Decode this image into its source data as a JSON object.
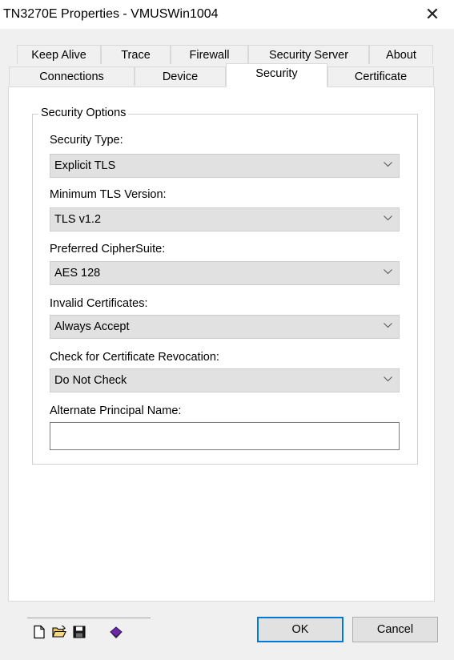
{
  "window": {
    "title": "TN3270E Properties - VMUSWin1004",
    "close_glyph": "✕"
  },
  "tabs": {
    "row1": [
      "Keep Alive",
      "Trace",
      "Firewall",
      "Security Server",
      "About"
    ],
    "row2": [
      "Connections",
      "Device",
      "Security",
      "Certificate"
    ],
    "active": "Security"
  },
  "security": {
    "group_title": "Security Options",
    "fields": [
      {
        "label": "Security Type:",
        "value": "Explicit TLS"
      },
      {
        "label": "Minimum TLS Version:",
        "value": "TLS v1.2"
      },
      {
        "label": "Preferred CipherSuite:",
        "value": "AES 128"
      },
      {
        "label": "Invalid Certificates:",
        "value": "Always Accept"
      },
      {
        "label": "Check for Certificate Revocation:",
        "value": "Do Not Check"
      }
    ],
    "alt_principal": {
      "label": "Alternate Principal Name:",
      "value": ""
    }
  },
  "toolbar": {
    "icons": [
      "new-document-icon",
      "open-folder-icon",
      "save-disk-icon",
      "book-icon"
    ]
  },
  "buttons": {
    "ok": "OK",
    "cancel": "Cancel"
  },
  "colors": {
    "default_button_border": "#0078d7",
    "panel_bg": "#ffffff",
    "window_bg": "#f0f0f0"
  }
}
